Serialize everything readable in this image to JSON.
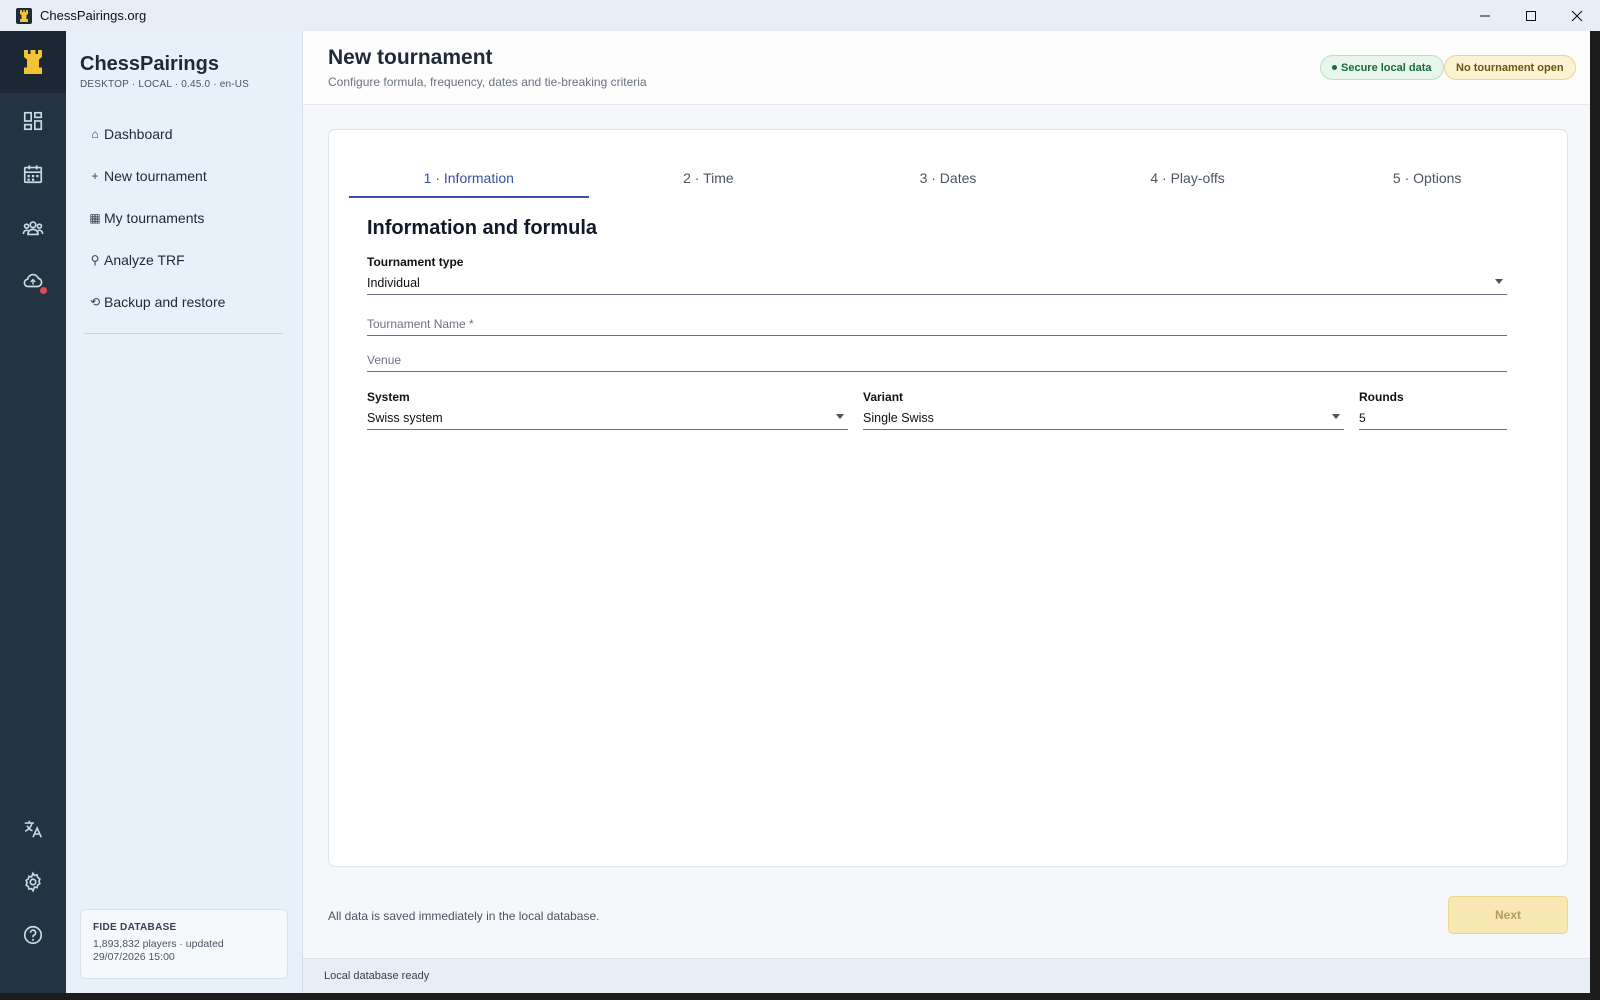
{
  "window": {
    "title": "ChessPairings.org"
  },
  "rail": {
    "items": [
      "dashboard-icon",
      "calendar-icon",
      "people-icon",
      "cloud-sync-icon"
    ],
    "bottom_items": [
      "translate-icon",
      "gear-icon",
      "help-icon"
    ],
    "accent": "#f2c335",
    "alert_color": "#e5484d"
  },
  "sidebar": {
    "brand": "ChessPairings",
    "meta": "DESKTOP · LOCAL · 0.45.0 · en-US",
    "nav": [
      {
        "icon": "⌂",
        "label": "Dashboard"
      },
      {
        "icon": "+",
        "label": "New tournament"
      },
      {
        "icon": "▦",
        "label": "My tournaments"
      },
      {
        "icon": "⚲",
        "label": "Analyze TRF"
      },
      {
        "icon": "⟲",
        "label": "Backup and restore"
      }
    ],
    "fide": {
      "title": "FIDE DATABASE",
      "text": "1,893,832 players · updated 29/07/2026 15:00"
    }
  },
  "header": {
    "title": "New tournament",
    "subtitle": "Configure formula, frequency, dates and tie-breaking criteria",
    "badge_secure": "Secure local data",
    "badge_status": "No tournament open"
  },
  "tabs": [
    {
      "label": "1 · Information",
      "active": true
    },
    {
      "label": "2 · Time",
      "active": false
    },
    {
      "label": "3 · Dates",
      "active": false
    },
    {
      "label": "4 · Play-offs",
      "active": false
    },
    {
      "label": "5 · Options",
      "active": false
    }
  ],
  "form": {
    "section_title": "Information and formula",
    "tournament_type_label": "Tournament type",
    "tournament_type_value": "Individual",
    "name_placeholder": "Tournament Name *",
    "venue_placeholder": "Venue",
    "system_label": "System",
    "system_value": "Swiss system",
    "variant_label": "Variant",
    "variant_value": "Single Swiss",
    "rounds_label": "Rounds",
    "rounds_value": "5"
  },
  "footer": {
    "note": "All data is saved immediately in the local database.",
    "next_label": "Next"
  },
  "status": {
    "text": "Local database ready"
  }
}
